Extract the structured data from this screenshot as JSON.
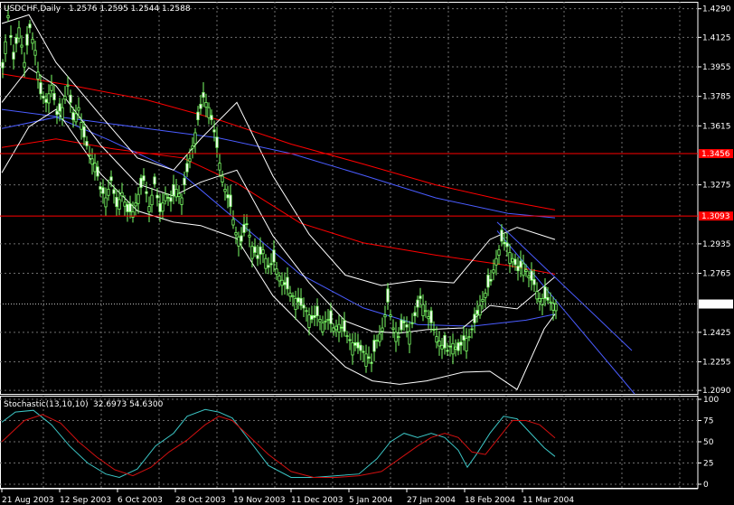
{
  "chart_data": [
    {
      "type": "candlestick",
      "title": "USDCHF,Daily",
      "ohlc_label": "1.2576 1.2595 1.2544 1.2588",
      "ylim": [
        1.207,
        1.433
      ],
      "y_ticks": [
        {
          "value": 1.429,
          "label": "1.4290"
        },
        {
          "value": 1.4125,
          "label": "1.4125"
        },
        {
          "value": 1.3955,
          "label": "1.3955"
        },
        {
          "value": 1.3785,
          "label": "1.3785"
        },
        {
          "value": 1.3615,
          "label": "1.3615"
        },
        {
          "value": 1.3275,
          "label": "1.3275"
        },
        {
          "value": 1.2935,
          "label": "1.2935"
        },
        {
          "value": 1.2765,
          "label": "1.2765"
        },
        {
          "value": 1.2425,
          "label": "1.2425"
        },
        {
          "value": 1.2255,
          "label": "1.2255"
        },
        {
          "value": 1.209,
          "label": "1.2090"
        }
      ],
      "price_levels": [
        {
          "value": 1.3455,
          "label": "1.3456",
          "color": "#ff0000"
        },
        {
          "value": 1.3095,
          "label": "1.3093",
          "color": "#ff0000"
        }
      ],
      "current_price": {
        "value": 1.2588,
        "label": "1.2588"
      },
      "x_tick_labels": [
        "21 Aug 2003",
        "12 Sep 2003",
        "6 Oct 2003",
        "28 Oct 2003",
        "19 Nov 2003",
        "11 Dec 2003",
        "5 Jan 2004",
        "27 Jan 2004",
        "18 Feb 2004",
        "11 Mar 2004"
      ],
      "close_path": [
        [
          0,
          1.395
        ],
        [
          6,
          1.425
        ],
        [
          12,
          1.4
        ],
        [
          18,
          1.418
        ],
        [
          24,
          1.398
        ],
        [
          30,
          1.418
        ],
        [
          36,
          1.405
        ],
        [
          42,
          1.38
        ],
        [
          48,
          1.375
        ],
        [
          54,
          1.385
        ],
        [
          60,
          1.368
        ],
        [
          66,
          1.372
        ],
        [
          72,
          1.385
        ],
        [
          78,
          1.365
        ],
        [
          84,
          1.372
        ],
        [
          90,
          1.355
        ],
        [
          96,
          1.345
        ],
        [
          102,
          1.34
        ],
        [
          108,
          1.325
        ],
        [
          114,
          1.32
        ],
        [
          120,
          1.33
        ],
        [
          126,
          1.315
        ],
        [
          132,
          1.323
        ],
        [
          138,
          1.312
        ],
        [
          144,
          1.312
        ],
        [
          150,
          1.322
        ],
        [
          156,
          1.33
        ],
        [
          162,
          1.315
        ],
        [
          168,
          1.328
        ],
        [
          174,
          1.312
        ],
        [
          180,
          1.322
        ],
        [
          186,
          1.318
        ],
        [
          192,
          1.325
        ],
        [
          198,
          1.32
        ],
        [
          204,
          1.335
        ],
        [
          210,
          1.35
        ],
        [
          216,
          1.365
        ],
        [
          222,
          1.378
        ],
        [
          228,
          1.372
        ],
        [
          234,
          1.358
        ],
        [
          240,
          1.34
        ],
        [
          246,
          1.325
        ],
        [
          252,
          1.315
        ],
        [
          258,
          1.3
        ],
        [
          264,
          1.295
        ],
        [
          270,
          1.305
        ],
        [
          276,
          1.292
        ],
        [
          282,
          1.285
        ],
        [
          288,
          1.29
        ],
        [
          294,
          1.28
        ],
        [
          300,
          1.283
        ],
        [
          306,
          1.275
        ],
        [
          312,
          1.27
        ],
        [
          318,
          1.265
        ],
        [
          324,
          1.262
        ],
        [
          330,
          1.258
        ],
        [
          336,
          1.255
        ],
        [
          342,
          1.25
        ],
        [
          348,
          1.252
        ],
        [
          354,
          1.248
        ],
        [
          360,
          1.25
        ],
        [
          366,
          1.245
        ],
        [
          372,
          1.247
        ],
        [
          378,
          1.243
        ],
        [
          384,
          1.238
        ],
        [
          390,
          1.235
        ],
        [
          396,
          1.232
        ],
        [
          402,
          1.23
        ],
        [
          408,
          1.225
        ],
        [
          414,
          1.238
        ],
        [
          420,
          1.245
        ],
        [
          426,
          1.26
        ],
        [
          432,
          1.245
        ],
        [
          438,
          1.24
        ],
        [
          444,
          1.248
        ],
        [
          450,
          1.243
        ],
        [
          456,
          1.252
        ],
        [
          462,
          1.262
        ],
        [
          468,
          1.255
        ],
        [
          474,
          1.248
        ],
        [
          480,
          1.24
        ],
        [
          486,
          1.235
        ],
        [
          492,
          1.232
        ],
        [
          498,
          1.236
        ],
        [
          504,
          1.232
        ],
        [
          510,
          1.238
        ],
        [
          516,
          1.24
        ],
        [
          522,
          1.248
        ],
        [
          528,
          1.258
        ],
        [
          534,
          1.265
        ],
        [
          540,
          1.272
        ],
        [
          546,
          1.285
        ],
        [
          552,
          1.295
        ],
        [
          558,
          1.292
        ],
        [
          564,
          1.285
        ],
        [
          570,
          1.278
        ],
        [
          576,
          1.282
        ],
        [
          582,
          1.275
        ],
        [
          588,
          1.27
        ],
        [
          594,
          1.262
        ],
        [
          600,
          1.262
        ],
        [
          606,
          1.26
        ],
        [
          612,
          1.2588
        ]
      ],
      "series": [
        {
          "color": "#ff0000",
          "points": [
            [
              0,
              1.3915
            ],
            [
              80,
              1.3845
            ],
            [
              160,
              1.3765
            ],
            [
              240,
              1.365
            ],
            [
              320,
              1.351
            ],
            [
              400,
              1.3395
            ],
            [
              480,
              1.3275
            ],
            [
              560,
              1.318
            ],
            [
              612,
              1.313
            ]
          ]
        },
        {
          "color": "#4a5cff",
          "points": [
            [
              0,
              1.371
            ],
            [
              80,
              1.3655
            ],
            [
              160,
              1.36
            ],
            [
              240,
              1.3545
            ],
            [
              320,
              1.3455
            ],
            [
              400,
              1.333
            ],
            [
              480,
              1.32
            ],
            [
              560,
              1.311
            ],
            [
              612,
              1.3085
            ]
          ]
        },
        {
          "color": "#ff0000",
          "points": [
            [
              0,
              1.349
            ],
            [
              60,
              1.354
            ],
            [
              120,
              1.3485
            ],
            [
              200,
              1.343
            ],
            [
              260,
              1.3285
            ],
            [
              330,
              1.3055
            ],
            [
              400,
              1.294
            ],
            [
              480,
              1.287
            ],
            [
              560,
              1.281
            ],
            [
              612,
              1.276
            ]
          ]
        },
        {
          "color": "#4a5cff",
          "points": [
            [
              0,
              1.36
            ],
            [
              60,
              1.3665
            ],
            [
              120,
              1.353
            ],
            [
              200,
              1.3335
            ],
            [
              260,
              1.307
            ],
            [
              330,
              1.276
            ],
            [
              400,
              1.2565
            ],
            [
              460,
              1.247
            ],
            [
              520,
              1.246
            ],
            [
              580,
              1.2495
            ],
            [
              612,
              1.253
            ]
          ]
        },
        {
          "color": "#ffffff",
          "points": [
            [
              0,
              1.3345
            ],
            [
              30,
              1.361
            ],
            [
              60,
              1.371
            ],
            [
              110,
              1.3335
            ],
            [
              150,
              1.3125
            ],
            [
              190,
              1.306
            ],
            [
              220,
              1.304
            ],
            [
              260,
              1.2965
            ],
            [
              300,
              1.2635
            ],
            [
              340,
              1.2425
            ],
            [
              380,
              1.2225
            ],
            [
              410,
              1.2145
            ],
            [
              440,
              1.2125
            ],
            [
              470,
              1.2145
            ],
            [
              510,
              1.2195
            ],
            [
              540,
              1.22
            ],
            [
              570,
              1.2095
            ],
            [
              600,
              1.2445
            ],
            [
              612,
              1.253
            ]
          ]
        },
        {
          "color": "#ffffff",
          "points": [
            [
              0,
              1.4205
            ],
            [
              30,
              1.4255
            ],
            [
              60,
              1.398
            ],
            [
              110,
              1.367
            ],
            [
              150,
              1.343
            ],
            [
              190,
              1.336
            ],
            [
              220,
              1.354
            ],
            [
              260,
              1.375
            ],
            [
              300,
              1.3325
            ],
            [
              340,
              1.299
            ],
            [
              380,
              1.2755
            ],
            [
              420,
              1.2695
            ],
            [
              460,
              1.2725
            ],
            [
              500,
              1.271
            ],
            [
              540,
              1.296
            ],
            [
              570,
              1.303
            ],
            [
              612,
              1.296
            ]
          ]
        },
        {
          "color": "#ffffff",
          "points": [
            [
              0,
              1.375
            ],
            [
              30,
              1.395
            ],
            [
              60,
              1.3845
            ],
            [
              110,
              1.35
            ],
            [
              150,
              1.328
            ],
            [
              190,
              1.321
            ],
            [
              220,
              1.329
            ],
            [
              260,
              1.336
            ],
            [
              300,
              1.298
            ],
            [
              340,
              1.271
            ],
            [
              380,
              1.249
            ],
            [
              410,
              1.243
            ],
            [
              440,
              1.242
            ],
            [
              470,
              1.244
            ],
            [
              510,
              1.245
            ],
            [
              540,
              1.258
            ],
            [
              570,
              1.256
            ],
            [
              612,
              1.2745
            ]
          ]
        },
        {
          "color": "#4a5cff",
          "points": [
            [
              548,
              1.301
            ],
            [
              700,
              1.207
            ]
          ]
        },
        {
          "color": "#4a5cff",
          "points": [
            [
              548,
              1.306
            ],
            [
              697,
              1.232
            ]
          ]
        }
      ]
    },
    {
      "type": "line",
      "title": "Stochastic(13,10,10)",
      "values_label": "32.6973 54.6300",
      "ylim": [
        0,
        100
      ],
      "y_ticks": [
        {
          "value": 100,
          "label": "100"
        },
        {
          "value": 75,
          "label": "75"
        },
        {
          "value": 50,
          "label": "50"
        },
        {
          "value": 25,
          "label": "25"
        },
        {
          "value": 0,
          "label": "0"
        }
      ],
      "series": [
        {
          "color": "#3cc6c6",
          "points": [
            [
              0,
              73
            ],
            [
              15,
              85
            ],
            [
              35,
              87
            ],
            [
              55,
              70
            ],
            [
              75,
              45
            ],
            [
              95,
              25
            ],
            [
              115,
              12
            ],
            [
              130,
              8
            ],
            [
              150,
              18
            ],
            [
              170,
              45
            ],
            [
              190,
              60
            ],
            [
              205,
              80
            ],
            [
              225,
              88
            ],
            [
              240,
              85
            ],
            [
              255,
              78
            ],
            [
              275,
              50
            ],
            [
              295,
              22
            ],
            [
              320,
              8
            ],
            [
              345,
              8
            ],
            [
              370,
              10
            ],
            [
              395,
              12
            ],
            [
              415,
              30
            ],
            [
              430,
              50
            ],
            [
              445,
              60
            ],
            [
              460,
              55
            ],
            [
              475,
              60
            ],
            [
              490,
              55
            ],
            [
              505,
              40
            ],
            [
              515,
              20
            ],
            [
              525,
              35
            ],
            [
              540,
              60
            ],
            [
              555,
              80
            ],
            [
              570,
              77
            ],
            [
              585,
              60
            ],
            [
              600,
              43
            ],
            [
              612,
              32.7
            ]
          ]
        },
        {
          "color": "#d01010",
          "points": [
            [
              0,
              50
            ],
            [
              25,
              75
            ],
            [
              45,
              82
            ],
            [
              65,
              72
            ],
            [
              85,
              50
            ],
            [
              105,
              32
            ],
            [
              125,
              17
            ],
            [
              145,
              10
            ],
            [
              165,
              20
            ],
            [
              185,
              38
            ],
            [
              205,
              52
            ],
            [
              225,
              70
            ],
            [
              240,
              80
            ],
            [
              255,
              75
            ],
            [
              275,
              55
            ],
            [
              295,
              35
            ],
            [
              320,
              15
            ],
            [
              345,
              8
            ],
            [
              370,
              8
            ],
            [
              395,
              10
            ],
            [
              420,
              15
            ],
            [
              440,
              30
            ],
            [
              460,
              45
            ],
            [
              475,
              55
            ],
            [
              490,
              60
            ],
            [
              505,
              55
            ],
            [
              520,
              38
            ],
            [
              535,
              35
            ],
            [
              550,
              55
            ],
            [
              565,
              75
            ],
            [
              580,
              75
            ],
            [
              595,
              70
            ],
            [
              612,
              54.6
            ]
          ]
        }
      ]
    }
  ]
}
